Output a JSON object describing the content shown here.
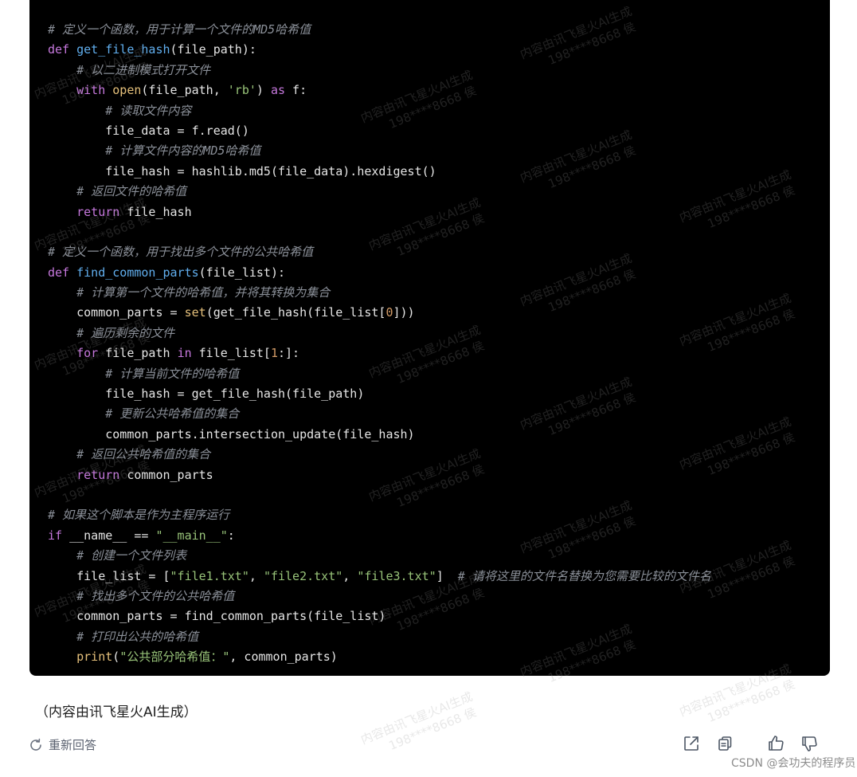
{
  "code": {
    "lines": [
      [
        {
          "t": "cm",
          "s": "# 定义一个函数，用于计算一个文件的MD5哈希值"
        }
      ],
      [
        {
          "t": "kw",
          "s": "def"
        },
        {
          "t": "tx",
          "s": " "
        },
        {
          "t": "fn",
          "s": "get_file_hash"
        },
        {
          "t": "tx",
          "s": "(file_path):"
        }
      ],
      [
        {
          "t": "tx",
          "s": "    "
        },
        {
          "t": "cm",
          "s": "# 以二进制模式打开文件"
        }
      ],
      [
        {
          "t": "tx",
          "s": "    "
        },
        {
          "t": "kw",
          "s": "with"
        },
        {
          "t": "tx",
          "s": " "
        },
        {
          "t": "bi",
          "s": "open"
        },
        {
          "t": "tx",
          "s": "(file_path, "
        },
        {
          "t": "st",
          "s": "'rb'"
        },
        {
          "t": "tx",
          "s": ") "
        },
        {
          "t": "kw",
          "s": "as"
        },
        {
          "t": "tx",
          "s": " f:"
        }
      ],
      [
        {
          "t": "tx",
          "s": "        "
        },
        {
          "t": "cm",
          "s": "# 读取文件内容"
        }
      ],
      [
        {
          "t": "tx",
          "s": "        file_data = f.read()"
        }
      ],
      [
        {
          "t": "tx",
          "s": "        "
        },
        {
          "t": "cm",
          "s": "# 计算文件内容的MD5哈希值"
        }
      ],
      [
        {
          "t": "tx",
          "s": "        file_hash = hashlib.md5(file_data).hexdigest()"
        }
      ],
      [
        {
          "t": "tx",
          "s": "    "
        },
        {
          "t": "cm",
          "s": "# 返回文件的哈希值"
        }
      ],
      [
        {
          "t": "tx",
          "s": "    "
        },
        {
          "t": "kw",
          "s": "return"
        },
        {
          "t": "tx",
          "s": " file_hash"
        }
      ],
      [
        {
          "t": "tx",
          "s": ""
        }
      ],
      [
        {
          "t": "cm",
          "s": "# 定义一个函数，用于找出多个文件的公共哈希值"
        }
      ],
      [
        {
          "t": "kw",
          "s": "def"
        },
        {
          "t": "tx",
          "s": " "
        },
        {
          "t": "fn",
          "s": "find_common_parts"
        },
        {
          "t": "tx",
          "s": "(file_list):"
        }
      ],
      [
        {
          "t": "tx",
          "s": "    "
        },
        {
          "t": "cm",
          "s": "# 计算第一个文件的哈希值，并将其转换为集合"
        }
      ],
      [
        {
          "t": "tx",
          "s": "    common_parts = "
        },
        {
          "t": "bi",
          "s": "set"
        },
        {
          "t": "tx",
          "s": "(get_file_hash(file_list["
        },
        {
          "t": "nu",
          "s": "0"
        },
        {
          "t": "tx",
          "s": "]))"
        }
      ],
      [
        {
          "t": "tx",
          "s": "    "
        },
        {
          "t": "cm",
          "s": "# 遍历剩余的文件"
        }
      ],
      [
        {
          "t": "tx",
          "s": "    "
        },
        {
          "t": "kw",
          "s": "for"
        },
        {
          "t": "tx",
          "s": " file_path "
        },
        {
          "t": "kw",
          "s": "in"
        },
        {
          "t": "tx",
          "s": " file_list["
        },
        {
          "t": "nu",
          "s": "1"
        },
        {
          "t": "tx",
          "s": ":]:"
        }
      ],
      [
        {
          "t": "tx",
          "s": "        "
        },
        {
          "t": "cm",
          "s": "# 计算当前文件的哈希值"
        }
      ],
      [
        {
          "t": "tx",
          "s": "        file_hash = get_file_hash(file_path)"
        }
      ],
      [
        {
          "t": "tx",
          "s": "        "
        },
        {
          "t": "cm",
          "s": "# 更新公共哈希值的集合"
        }
      ],
      [
        {
          "t": "tx",
          "s": "        common_parts.intersection_update(file_hash)"
        }
      ],
      [
        {
          "t": "tx",
          "s": "    "
        },
        {
          "t": "cm",
          "s": "# 返回公共哈希值的集合"
        }
      ],
      [
        {
          "t": "tx",
          "s": "    "
        },
        {
          "t": "kw",
          "s": "return"
        },
        {
          "t": "tx",
          "s": " common_parts"
        }
      ],
      [
        {
          "t": "tx",
          "s": ""
        }
      ],
      [
        {
          "t": "cm",
          "s": "# 如果这个脚本是作为主程序运行"
        }
      ],
      [
        {
          "t": "kw",
          "s": "if"
        },
        {
          "t": "tx",
          "s": " __name__ == "
        },
        {
          "t": "st",
          "s": "\"__main__\""
        },
        {
          "t": "tx",
          "s": ":"
        }
      ],
      [
        {
          "t": "tx",
          "s": "    "
        },
        {
          "t": "cm",
          "s": "# 创建一个文件列表"
        }
      ],
      [
        {
          "t": "tx",
          "s": "    file_list = ["
        },
        {
          "t": "st",
          "s": "\"file1.txt\""
        },
        {
          "t": "tx",
          "s": ", "
        },
        {
          "t": "st",
          "s": "\"file2.txt\""
        },
        {
          "t": "tx",
          "s": ", "
        },
        {
          "t": "st",
          "s": "\"file3.txt\""
        },
        {
          "t": "tx",
          "s": "]  "
        },
        {
          "t": "cm",
          "s": "# 请将这里的文件名替换为您需要比较的文件名"
        }
      ],
      [
        {
          "t": "tx",
          "s": "    "
        },
        {
          "t": "cm",
          "s": "# 找出多个文件的公共哈希值"
        }
      ],
      [
        {
          "t": "tx",
          "s": "    common_parts = find_common_parts(file_list)"
        }
      ],
      [
        {
          "t": "tx",
          "s": "    "
        },
        {
          "t": "cm",
          "s": "# 打印出公共的哈希值"
        }
      ],
      [
        {
          "t": "tx",
          "s": "    "
        },
        {
          "t": "bi",
          "s": "print"
        },
        {
          "t": "tx",
          "s": "("
        },
        {
          "t": "st",
          "s": "\"公共部分哈希值：\""
        },
        {
          "t": "tx",
          "s": ", common_parts)"
        }
      ]
    ]
  },
  "footnote": "（内容由讯飞星火AI生成）",
  "regenerate_label": "重新回答",
  "actions": {
    "share_icon": "share-icon",
    "copy_icon": "copy-icon",
    "like_icon": "thumbs-up-icon",
    "dislike_icon": "thumbs-down-icon"
  },
  "corner_watermark": "CSDN @会功夫的程序员",
  "watermark": {
    "line1": "内容由讯飞星火AI生成",
    "line2": "198****8668 侯"
  },
  "colors": {
    "code_bg": "#000000",
    "keyword": "#c678dd",
    "function": "#61afef",
    "comment": "#8a8f98",
    "string": "#98c379",
    "number": "#d19a66",
    "builtin": "#e5c07b"
  }
}
